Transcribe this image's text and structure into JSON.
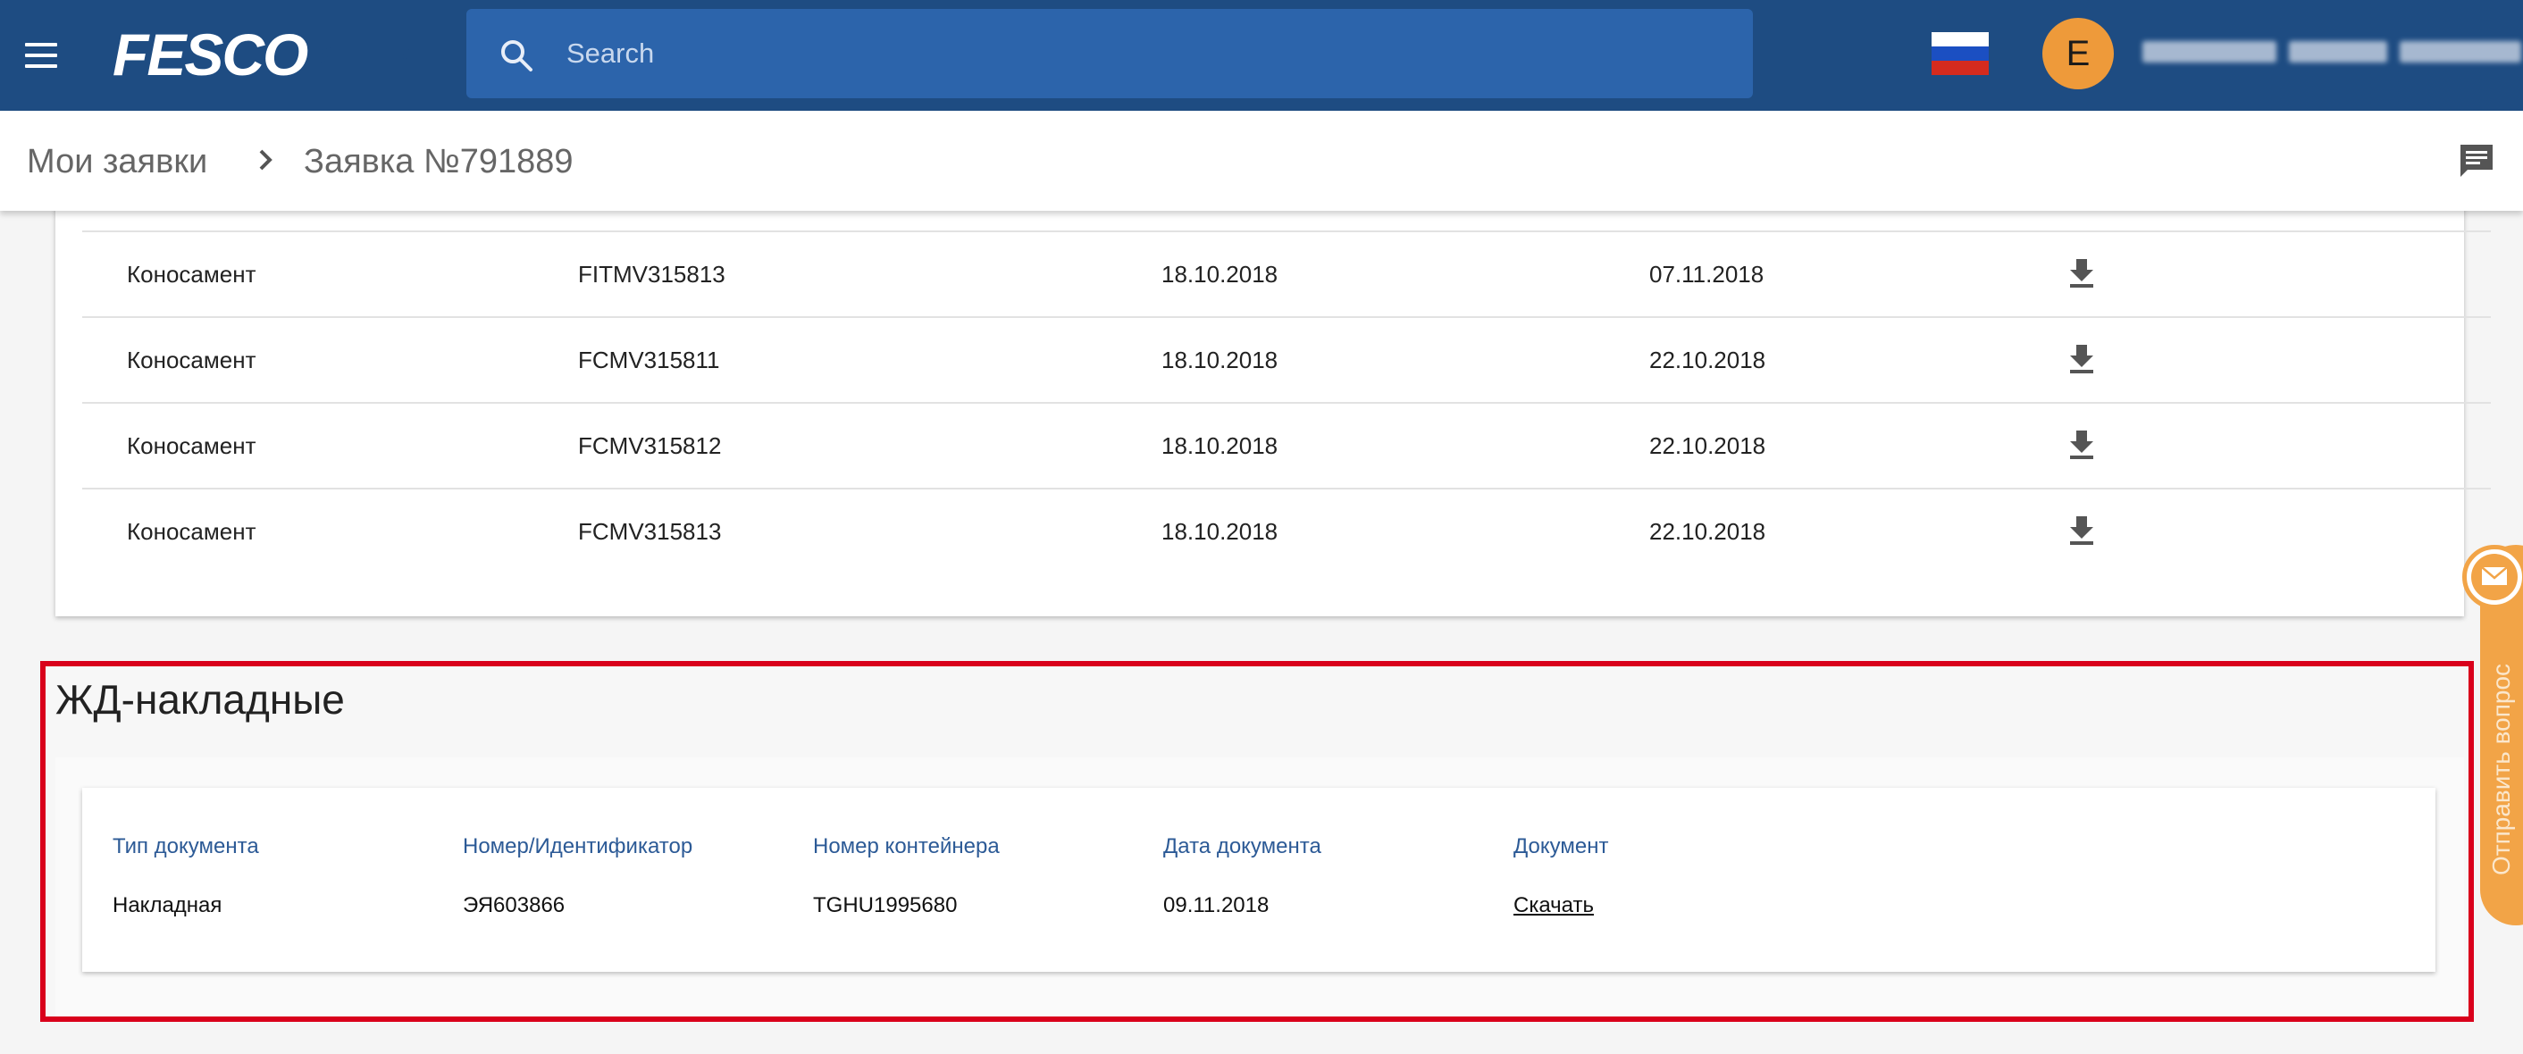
{
  "header": {
    "brand": "FESCO",
    "search_placeholder": "Search",
    "language_flag": "russia-flag",
    "avatar_initial": "E",
    "menu_icon": "menu-icon"
  },
  "breadcrumb": {
    "parent": "Мои заявки",
    "current": "Заявка №791889",
    "separator_icon": "chevron-right-icon",
    "chat_icon": "chat-icon"
  },
  "bills_of_lading": {
    "rows": [
      {
        "type": "Коносамент",
        "number": "FITMV315813",
        "date1": "18.10.2018",
        "date2": "07.11.2018"
      },
      {
        "type": "Коносамент",
        "number": "FCMV315811",
        "date1": "18.10.2018",
        "date2": "22.10.2018"
      },
      {
        "type": "Коносамент",
        "number": "FCMV315812",
        "date1": "18.10.2018",
        "date2": "22.10.2018"
      },
      {
        "type": "Коносамент",
        "number": "FCMV315813",
        "date1": "18.10.2018",
        "date2": "22.10.2018"
      }
    ],
    "download_icon": "download-icon"
  },
  "railway_waybills": {
    "title": "ЖД-накладные",
    "columns": [
      "Тип документа",
      "Номер/Идентификатор",
      "Номер контейнера",
      "Дата документа",
      "Документ"
    ],
    "row": {
      "type": "Накладная",
      "number": "ЭЯ603866",
      "container": "TGHU1995680",
      "date": "09.11.2018",
      "document": "Скачать"
    }
  },
  "feedback": {
    "label": "Отправить вопрос",
    "icon": "mail-icon"
  },
  "colors": {
    "header_bg": "#1e4c82",
    "search_bg": "#2c64ab",
    "avatar": "#ee9a3a",
    "highlight": "#d9001b",
    "feedback": "#f2a447",
    "column_header": "#2c5a96"
  }
}
